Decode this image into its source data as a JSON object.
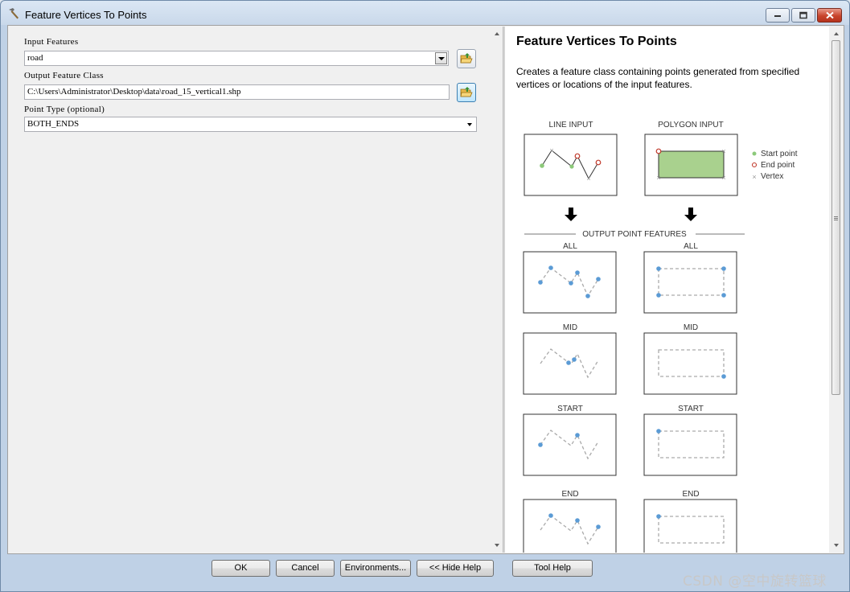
{
  "window": {
    "title": "Feature Vertices To Points"
  },
  "form": {
    "input_features": {
      "label": "Input Features",
      "value": "road"
    },
    "output_feature_class": {
      "label": "Output Feature Class",
      "value": "C:\\Users\\Administrator\\Desktop\\data\\road_15_vertical1.shp"
    },
    "point_type": {
      "label": "Point Type (optional)",
      "value": "BOTH_ENDS"
    }
  },
  "help": {
    "title": "Feature Vertices To Points",
    "description": "Creates a feature class containing points generated from specified vertices or locations of the input features.",
    "diagram": {
      "line_input": "LINE INPUT",
      "polygon_input": "POLYGON INPUT",
      "legend_start": "Start point",
      "legend_end": "End point",
      "legend_vertex": "Vertex",
      "output_heading": "OUTPUT POINT FEATURES",
      "rows": [
        "ALL",
        "MID",
        "START",
        "END"
      ]
    }
  },
  "buttons": {
    "ok": "OK",
    "cancel": "Cancel",
    "environments": "Environments...",
    "hide_help": "<< Hide Help",
    "tool_help": "Tool Help"
  },
  "watermark": "CSDN @空中旋转篮球",
  "colors": {
    "point_blue": "#5b9bd5",
    "start_green": "#8cc97a",
    "end_red": "#c0392b",
    "polygon_fill": "#a9d18e"
  }
}
